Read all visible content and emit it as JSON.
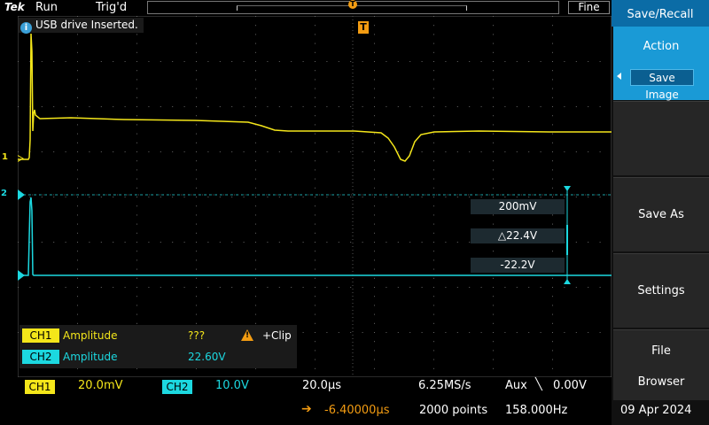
{
  "topbar": {
    "brand": "Tek",
    "run_state": "Run",
    "trigger_state": "Trig'd",
    "fine_label": "Fine",
    "record_trigger_marker": "T"
  },
  "notification": {
    "icon": "info-icon",
    "icon_glyph": "i",
    "text": "USB drive Inserted."
  },
  "trigger_marker": "T",
  "channel_markers": {
    "ch1": "1",
    "ch2": "2"
  },
  "cursor_readouts": {
    "scale": "200mV",
    "delta": "△22.4V",
    "position": "-22.2V"
  },
  "measurements": [
    {
      "channel": "CH1",
      "name": "Amplitude",
      "value": "???",
      "warning": "+Clip",
      "warning_icon": "warning-icon"
    },
    {
      "channel": "CH2",
      "name": "Amplitude",
      "value": "22.60V"
    }
  ],
  "status_bar": {
    "ch1_label": "CH1",
    "ch1_scale": "20.0mV",
    "ch2_label": "CH2",
    "ch2_scale": "10.0V",
    "time_scale": "20.0µs",
    "sample_rate": "6.25MS/s",
    "aux_label": "Aux",
    "trigger_slope": "╲",
    "trigger_level": "0.00V",
    "delay_arrow": "➔",
    "horizontal_delay": "-6.40000µs",
    "record_length": "2000 points",
    "trigger_frequency": "158.000Hz"
  },
  "menu": {
    "title": "Save/Recall",
    "action_label": "Action",
    "action_value": "Save Image",
    "items": [
      "Save As",
      "Settings"
    ],
    "file_browser_line1": "File",
    "file_browser_line2": "Browser"
  },
  "date": "09 Apr 2024",
  "colors": {
    "ch1": "#f4e61a",
    "ch2": "#1cd8e0",
    "trigger": "#f39c12",
    "menu_accent": "#1a9ad6"
  }
}
